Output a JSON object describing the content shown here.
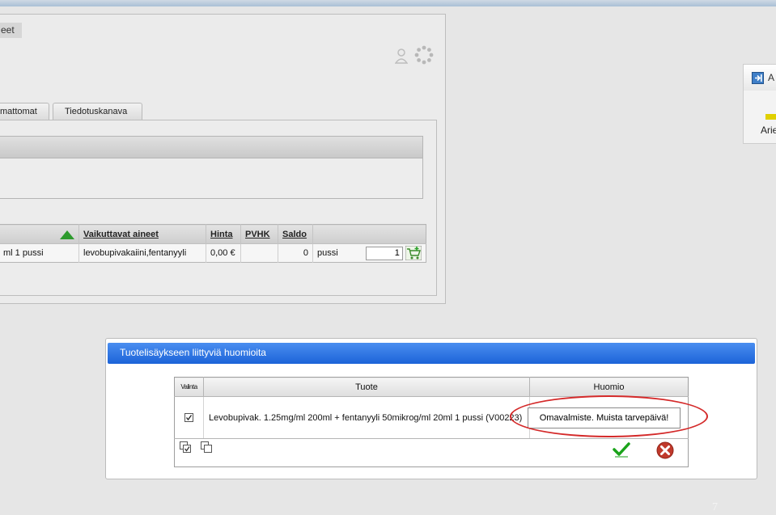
{
  "panel": {
    "title": "eet"
  },
  "tabs": [
    {
      "label": "mattomat"
    },
    {
      "label": "Tiedotuskanava"
    }
  ],
  "product_table": {
    "columns": [
      "",
      "Vaikuttavat aineet",
      "Hinta",
      "PVHK",
      "Saldo",
      ""
    ],
    "row": {
      "name": "ml 1 pussi",
      "substances": "levobupivakaiini,fentanyyli",
      "price": "0,00 €",
      "pvhk": "",
      "balance": "0",
      "unit": "pussi",
      "quantity": "1"
    }
  },
  "right_widget": {
    "title": "A",
    "label": "Arie"
  },
  "dialog": {
    "title": "Tuotelisäykseen liittyviä huomioita",
    "columns": {
      "valinta": "Valinta",
      "tuote": "Tuote",
      "huomio": "Huomio"
    },
    "row": {
      "product": "Levobupivak. 1.25mg/ml 200ml + fentanyyli 50mikrog/ml 20ml 1 pussi (V00223)",
      "note": "Omavalmiste. Muista tarvepäivä!",
      "checked": true
    }
  },
  "page_number": "7",
  "colors": {
    "dialog_header": "#1c63d8",
    "annotation": "#d42a2a",
    "ok": "#1aa31a",
    "cancel": "#c0392b"
  }
}
